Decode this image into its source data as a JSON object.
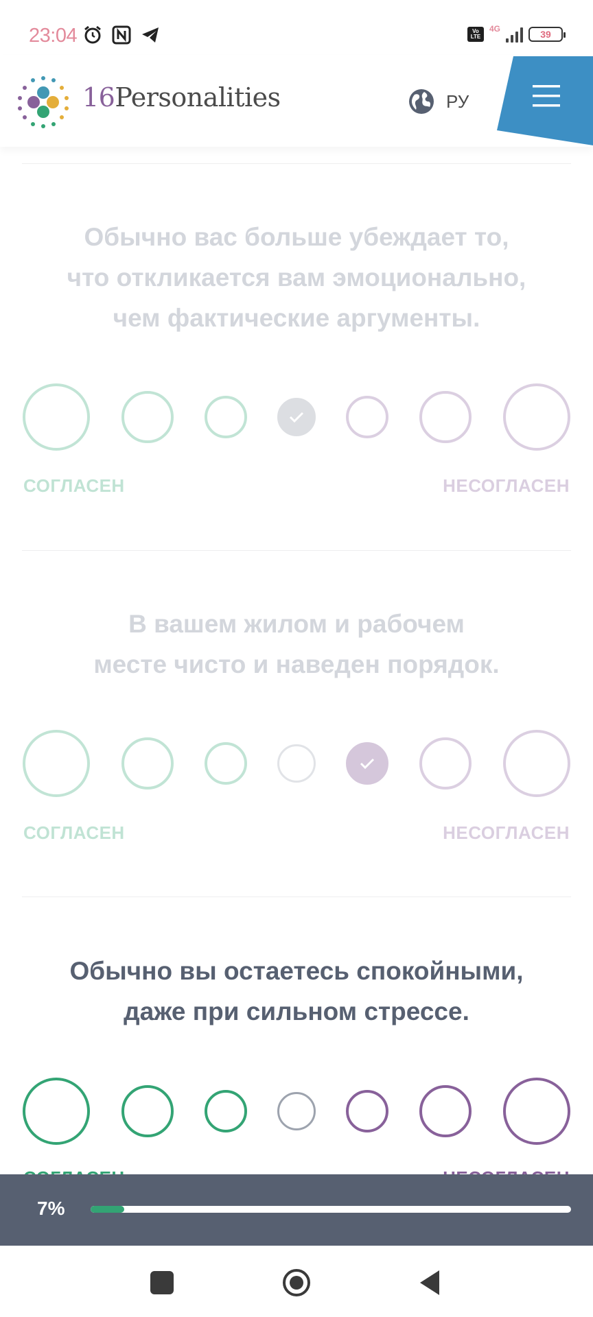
{
  "status_bar": {
    "time": "23:04",
    "volte": "Vo\nLTE",
    "network": "4G",
    "battery": "39",
    "icons": [
      "alarm-icon",
      "nfc-icon",
      "telegram-icon"
    ]
  },
  "header": {
    "logo_number": "16",
    "logo_word": "Personalities",
    "language_label": "РУ",
    "menu_color": "#3d8fc4"
  },
  "colors": {
    "agree": "#33a474",
    "disagree": "#88619a",
    "neutral": "#9da3ae",
    "text": "#576071"
  },
  "questions": [
    {
      "text_lines": [
        "Обычно вас больше убеждает то,",
        "что откликается вам эмоционально,",
        "чем фактические аргументы."
      ],
      "faded": true,
      "selected": 4,
      "agree_label": "СОГЛАСЕН",
      "disagree_label": "НЕСОГЛАСЕН"
    },
    {
      "text_lines": [
        "В вашем жилом и рабочем",
        "месте чисто и наведен порядок."
      ],
      "faded": true,
      "selected": 5,
      "agree_label": "СОГЛАСЕН",
      "disagree_label": "НЕСОГЛАСЕН"
    },
    {
      "text_lines": [
        "Обычно вы остаетесь спокойными,",
        "даже при сильном стрессе."
      ],
      "faded": false,
      "selected": null,
      "agree_label": "СОГЛАСЕН",
      "disagree_label": "НЕСОГЛАСЕН"
    }
  ],
  "progress": {
    "label": "7%",
    "value": 0.07
  },
  "navbar": {
    "icons": [
      "recents-icon",
      "home-icon",
      "back-icon"
    ]
  }
}
